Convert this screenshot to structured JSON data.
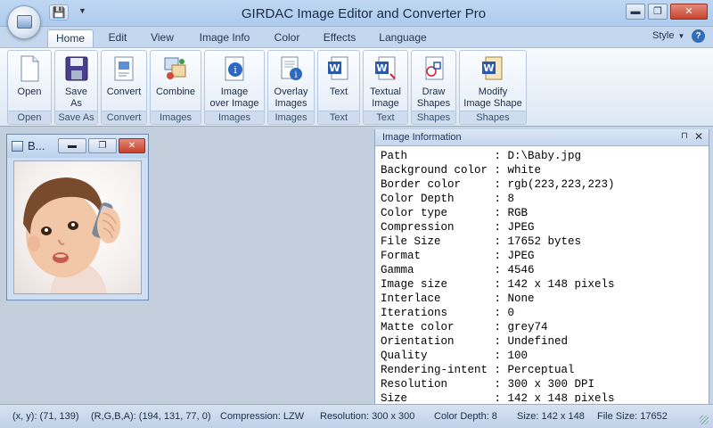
{
  "window": {
    "title": "GIRDAC Image Editor and Converter Pro",
    "min": "▬",
    "max": "❐",
    "close": "✕"
  },
  "tabs": [
    "Home",
    "Edit",
    "View",
    "Image Info",
    "Color",
    "Effects",
    "Language"
  ],
  "style": {
    "label": "Style",
    "help": "?"
  },
  "ribbon": {
    "groups": [
      {
        "label": "Open",
        "buttons": [
          {
            "label": "Open",
            "icon": "open-file-icon"
          }
        ]
      },
      {
        "label": "Save As",
        "buttons": [
          {
            "label": "Save\nAs",
            "icon": "floppy-disk-icon"
          }
        ]
      },
      {
        "label": "Convert",
        "buttons": [
          {
            "label": "Convert",
            "icon": "convert-icon"
          }
        ]
      },
      {
        "label": "Images",
        "buttons": [
          {
            "label": "Combine",
            "icon": "combine-images-icon"
          }
        ]
      },
      {
        "label": "Images",
        "buttons": [
          {
            "label": "Image\nover Image",
            "icon": "image-over-image-icon"
          }
        ]
      },
      {
        "label": "Images",
        "buttons": [
          {
            "label": "Overlay\nImages",
            "icon": "overlay-images-icon"
          }
        ]
      },
      {
        "label": "Text",
        "buttons": [
          {
            "label": "Text",
            "icon": "text-document-icon"
          }
        ]
      },
      {
        "label": "Text",
        "buttons": [
          {
            "label": "Textual\nImage",
            "icon": "textual-image-icon"
          }
        ]
      },
      {
        "label": "Shapes",
        "buttons": [
          {
            "label": "Draw\nShapes",
            "icon": "draw-shapes-icon"
          }
        ]
      },
      {
        "label": "Shapes",
        "buttons": [
          {
            "label": "Modify\nImage Shape",
            "icon": "modify-shape-icon"
          }
        ]
      }
    ]
  },
  "child_window": {
    "title": "B...",
    "min": "▬",
    "max": "❐",
    "close": "✕"
  },
  "info_panel": {
    "title": "Image Information",
    "pin": "⊓",
    "close": "✕",
    "rows": [
      {
        "key": "Path",
        "value": "D:\\Baby.jpg"
      },
      {
        "key": "Background color",
        "value": "white"
      },
      {
        "key": "Border color",
        "value": "rgb(223,223,223)"
      },
      {
        "key": "Color Depth",
        "value": "8"
      },
      {
        "key": "Color type",
        "value": "RGB"
      },
      {
        "key": "Compression",
        "value": "JPEG"
      },
      {
        "key": "File Size",
        "value": "17652 bytes"
      },
      {
        "key": "Format",
        "value": "JPEG"
      },
      {
        "key": "Gamma",
        "value": "4546"
      },
      {
        "key": "Image size",
        "value": "142 x 148 pixels"
      },
      {
        "key": "Interlace",
        "value": "None"
      },
      {
        "key": "Iterations",
        "value": "0"
      },
      {
        "key": "Matte color",
        "value": "grey74"
      },
      {
        "key": "Orientation",
        "value": "Undefined"
      },
      {
        "key": "Quality",
        "value": "100"
      },
      {
        "key": "Rendering-intent",
        "value": "Perceptual"
      },
      {
        "key": "Resolution",
        "value": "300 x 300 DPI"
      },
      {
        "key": "Size",
        "value": "142 x 148 pixels"
      }
    ]
  },
  "status": {
    "xy": "(x, y): (71, 139)",
    "rgba": "(R,G,B,A): (194, 131, 77, 0)",
    "compression": "Compression: LZW",
    "resolution": "Resolution: 300 x 300",
    "color_depth": "Color Depth: 8",
    "size": "Size: 142 x 148",
    "file_size": "File Size: 17652"
  }
}
